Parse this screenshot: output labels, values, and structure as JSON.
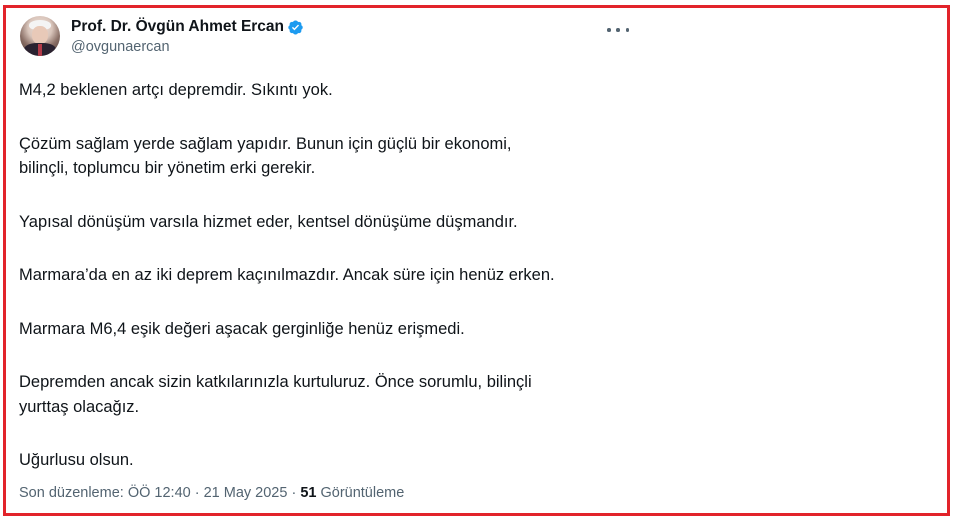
{
  "frame_color": "#e2232a",
  "author": {
    "display_name": "Prof. Dr. Övgün Ahmet Ercan",
    "handle": "@ovgunaercan",
    "verified": true,
    "verified_color": "#1d9bf0",
    "avatar": "avatar-photo"
  },
  "menu": {
    "icon": "more-options-icon"
  },
  "tweet": {
    "paragraphs": [
      [
        "M4,2 beklenen artçı depremdir. Sıkıntı yok."
      ],
      [
        "Çözüm sağlam yerde sağlam yapıdır. Bunun için güçlü bir ekonomi,",
        "bilinçli, toplumcu bir yönetim erki gerekir."
      ],
      [
        "Yapısal dönüşüm varsıla hizmet eder, kentsel dönüşüme düşmandır."
      ],
      [
        "Marmara’da en az iki deprem kaçınılmazdır. Ancak süre için henüz erken."
      ],
      [
        "Marmara M6,4 eşik değeri aşacak gerginliğe henüz erişmedi."
      ],
      [
        "Depremden ancak sizin katkılarınızla kurtuluruz. Önce sorumlu, bilinçli",
        "yurttaş olacağız."
      ],
      [
        "Uğurlusu olsun."
      ]
    ]
  },
  "meta": {
    "edited_label": "Son düzenleme: ÖÖ 12:40 · 21 May 2025 · ",
    "views_count": "51",
    "views_label": " Görüntüleme"
  }
}
